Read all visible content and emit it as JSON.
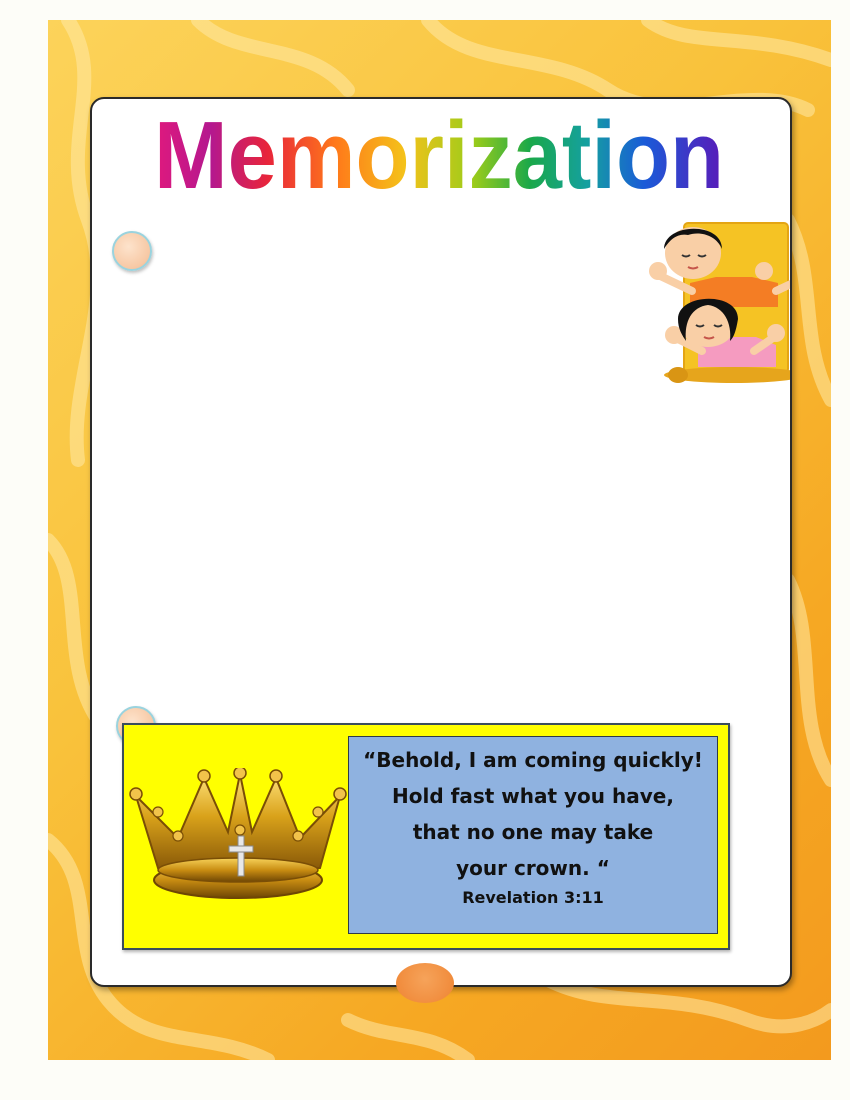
{
  "page": {
    "title": "Memorization",
    "title_colors": [
      "#e0197d",
      "#c0198e",
      "#7a1fa0",
      "#e8253a",
      "#ff6a1a",
      "#ff9f1a",
      "#f4c21a",
      "#9ccc1a",
      "#1aa84a",
      "#14a0a0",
      "#1a5bd8",
      "#3a1ab8"
    ]
  },
  "verse": {
    "lines": [
      "“Behold, I am coming quickly!",
      "Hold fast what you have,",
      "that no one may take",
      "your crown. “"
    ],
    "reference": "Revelation 3:11"
  },
  "colors": {
    "frame": "#f6a823",
    "verse_box": "#ffff00",
    "verse_panel": "#8fb2e0",
    "crown": "#d9a21a"
  },
  "icons": [
    "praying-children-illustration",
    "gold-crown-icon",
    "pin-icon"
  ]
}
